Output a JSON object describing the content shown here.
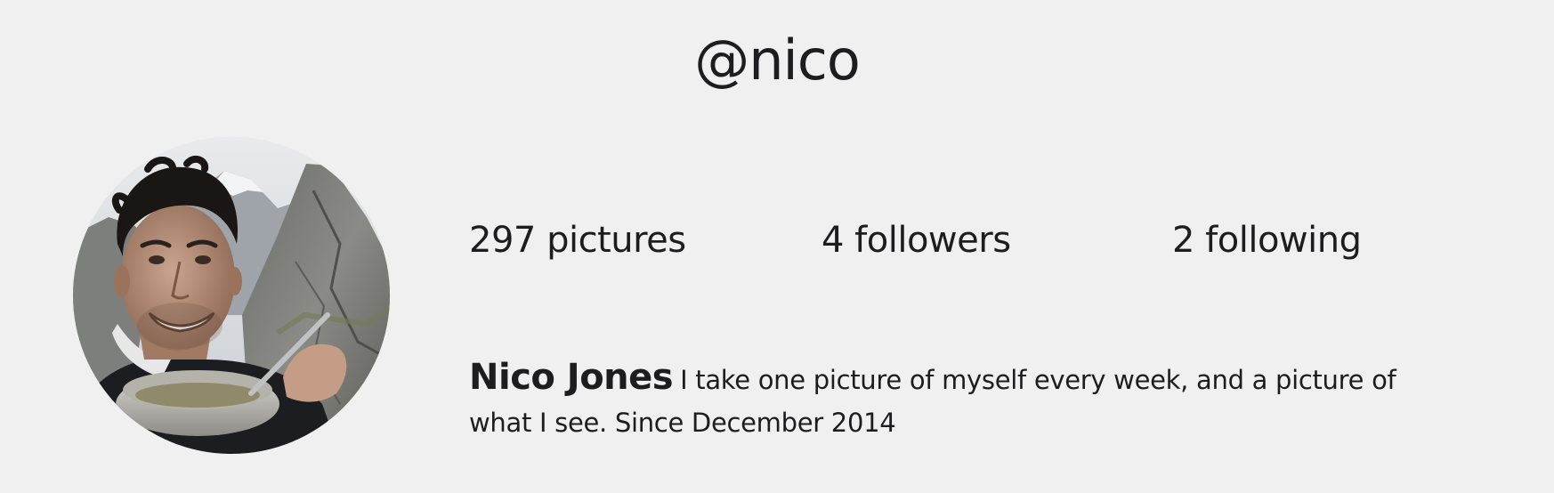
{
  "profile": {
    "username": "@nico",
    "stats": {
      "pictures": "297 pictures",
      "followers": "4 followers",
      "following": "2 following"
    },
    "name": "Nico Jones",
    "bio": "I take one picture of myself every week, and a picture of what I see. Since December 2014"
  }
}
